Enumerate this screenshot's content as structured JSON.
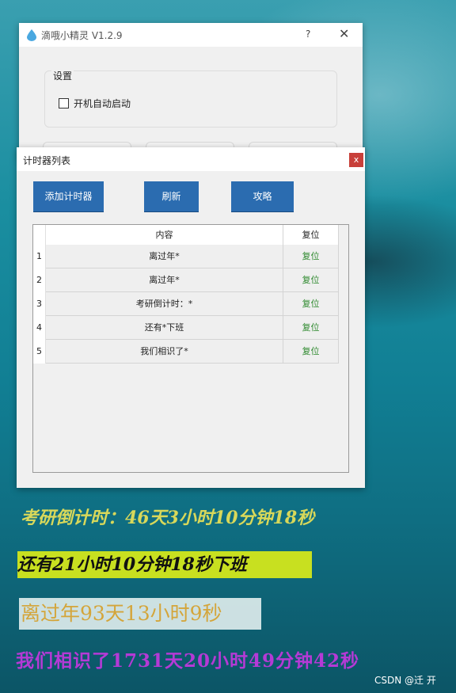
{
  "main_window": {
    "title": "滴哦小精灵 V1.2.9",
    "help_label": "?",
    "close_label": "✕",
    "group_label": "设置",
    "autostart_label": "开机自动启动",
    "autostart_checked": false
  },
  "timer_window": {
    "title": "计时器列表",
    "close_label": "x",
    "buttons": {
      "add": "添加计时器",
      "refresh": "刷新",
      "guide": "攻略"
    },
    "table": {
      "headers": {
        "content": "内容",
        "reset": "复位"
      },
      "rows": [
        {
          "index": "1",
          "content": "离过年*",
          "action": "复位"
        },
        {
          "index": "2",
          "content": "离过年*",
          "action": "复位"
        },
        {
          "index": "3",
          "content": "考研倒计时：*",
          "action": "复位"
        },
        {
          "index": "4",
          "content": "还有*下班",
          "action": "复位"
        },
        {
          "index": "5",
          "content": "我们相识了*",
          "action": "复位"
        }
      ]
    }
  },
  "overlays": {
    "kaoyan": "考研倒计时：46天3小时10分钟18秒",
    "xiaban": "还有21小时10分钟18秒下班",
    "guonian": "离过年93天13小时9秒",
    "xiangshi": "我们相识了1731天20小时49分钟42秒"
  },
  "watermark": "CSDN @迁  开",
  "colors": {
    "button_blue": "#2b6cb0",
    "reset_green": "#2f8a2f",
    "close_red": "#c8403a"
  }
}
